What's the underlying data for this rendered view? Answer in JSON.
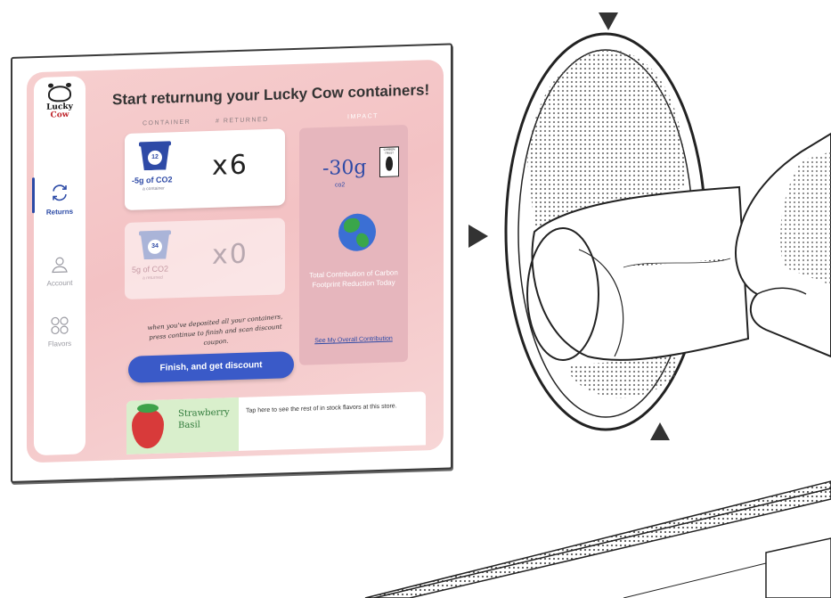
{
  "sidebar": {
    "logo_text_top": "Lucky",
    "logo_text_bottom": "Cow",
    "items": [
      {
        "label": "Returns",
        "icon": "refresh-icon",
        "active": true
      },
      {
        "label": "Account",
        "icon": "user-icon",
        "active": false
      },
      {
        "label": "Flavors",
        "icon": "grid-icon",
        "active": false
      }
    ]
  },
  "main": {
    "title": "Start returnung your Lucky Cow containers!",
    "columns": {
      "container": "CONTAINER",
      "returned": "# RETURNED",
      "impact": "IMPACT"
    }
  },
  "containers": [
    {
      "size": "12",
      "size_unit": "oz",
      "co2": "-5g of CO2",
      "co2_note": "a container",
      "count": "x6",
      "active": true
    },
    {
      "size": "34",
      "size_unit": "oz",
      "co2": "5g of CO2",
      "co2_note": "a returned",
      "count": "x0",
      "active": false
    }
  ],
  "instructions": "when you've deposited all your containers, press continue to finish and scan discount coupon.",
  "finish_button": "Finish, and get discount",
  "impact": {
    "value": "-30g",
    "unit": "co2",
    "label_title": "CARBON TRUST",
    "description": "Total Contribution of Carbon Footprint Reduction Today",
    "link": "See My Overall Contribution"
  },
  "flavor_banner": {
    "flavor_name_line1": "Strawberry",
    "flavor_name_line2": "Basil",
    "cta": "Tap here to see the rest of in stock flavors at this store."
  },
  "colors": {
    "accent": "#3a5ac8",
    "brand_blue": "#2e4aa6",
    "pink_bg": "#f3c2c4",
    "impact_bg": "#e6b6bd",
    "earth_green": "#3aa64a"
  }
}
